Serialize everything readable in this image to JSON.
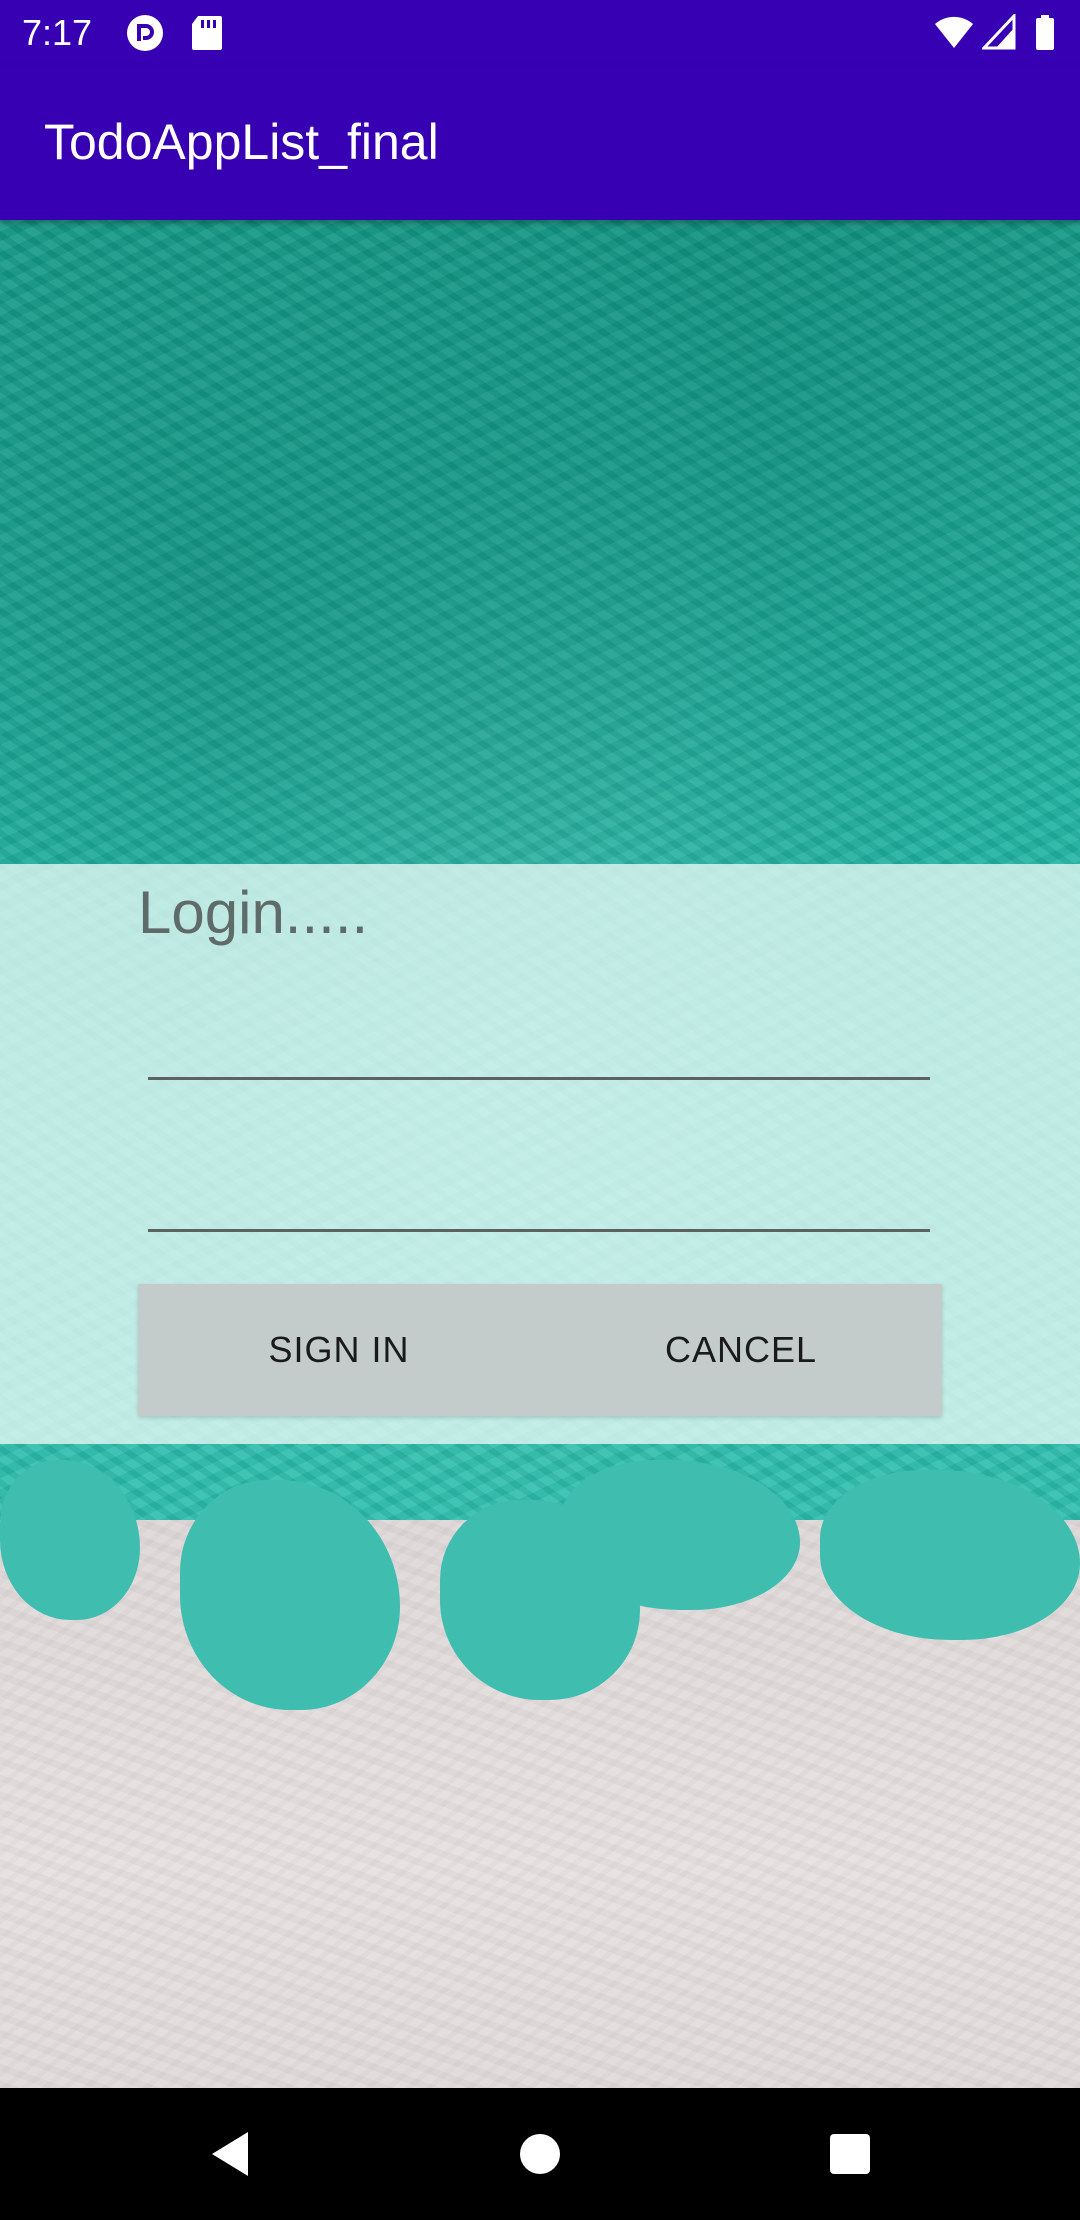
{
  "status_bar": {
    "time": "7:17",
    "icons": [
      "pocket-casts-icon",
      "sd-card-icon",
      "wifi-icon",
      "cell-signal-icon",
      "battery-icon"
    ]
  },
  "app_bar": {
    "title": "TodoAppList_final",
    "color": "#3700b3"
  },
  "login": {
    "title": "Login.....",
    "username_value": "",
    "password_value": "",
    "sign_in_label": "SIGN IN",
    "cancel_label": "CANCEL"
  },
  "nav_bar": {
    "icons": [
      "back-icon",
      "home-icon",
      "recents-icon"
    ]
  }
}
